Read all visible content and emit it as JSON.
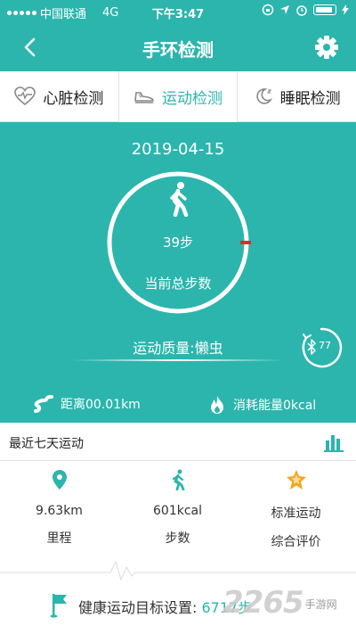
{
  "status_bar": {
    "carrier": "中国联通",
    "network": "4G",
    "time": "下午3:47"
  },
  "header": {
    "title": "手环检测",
    "back_icon": "chevron-left-icon",
    "settings_icon": "gear-icon"
  },
  "tabs": [
    {
      "label": "心脏检测",
      "icon": "heart-pulse-icon",
      "active": false
    },
    {
      "label": "运动检测",
      "icon": "sneaker-icon",
      "active": true
    },
    {
      "label": "睡眠检测",
      "icon": "moon-icon",
      "active": false
    }
  ],
  "activity": {
    "date": "2019-04-15",
    "steps": "39步",
    "steps_label": "当前总步数",
    "progress_fraction": 0.0,
    "quality": "运动质量:懒虫",
    "bt_value": "77",
    "distance": "距离00.01km",
    "calories": "消耗能量0kcal"
  },
  "recent": {
    "label": "最近七天运动"
  },
  "summary": [
    {
      "value": "9.63km",
      "label": "里程",
      "icon": "location-pin-icon"
    },
    {
      "value": "601kcal",
      "label": "步数",
      "icon": "runner-icon"
    },
    {
      "value": "标准运动",
      "label": "综合评价",
      "icon": "star-badge-icon"
    }
  ],
  "goal": {
    "text": "健康运动目标设置:",
    "value": "6717步"
  },
  "watermark": {
    "big": "2265",
    "small": "手游网"
  },
  "colors": {
    "accent": "#2bb5ad",
    "progress_marker": "#e02828",
    "star": "#f2a71b"
  }
}
